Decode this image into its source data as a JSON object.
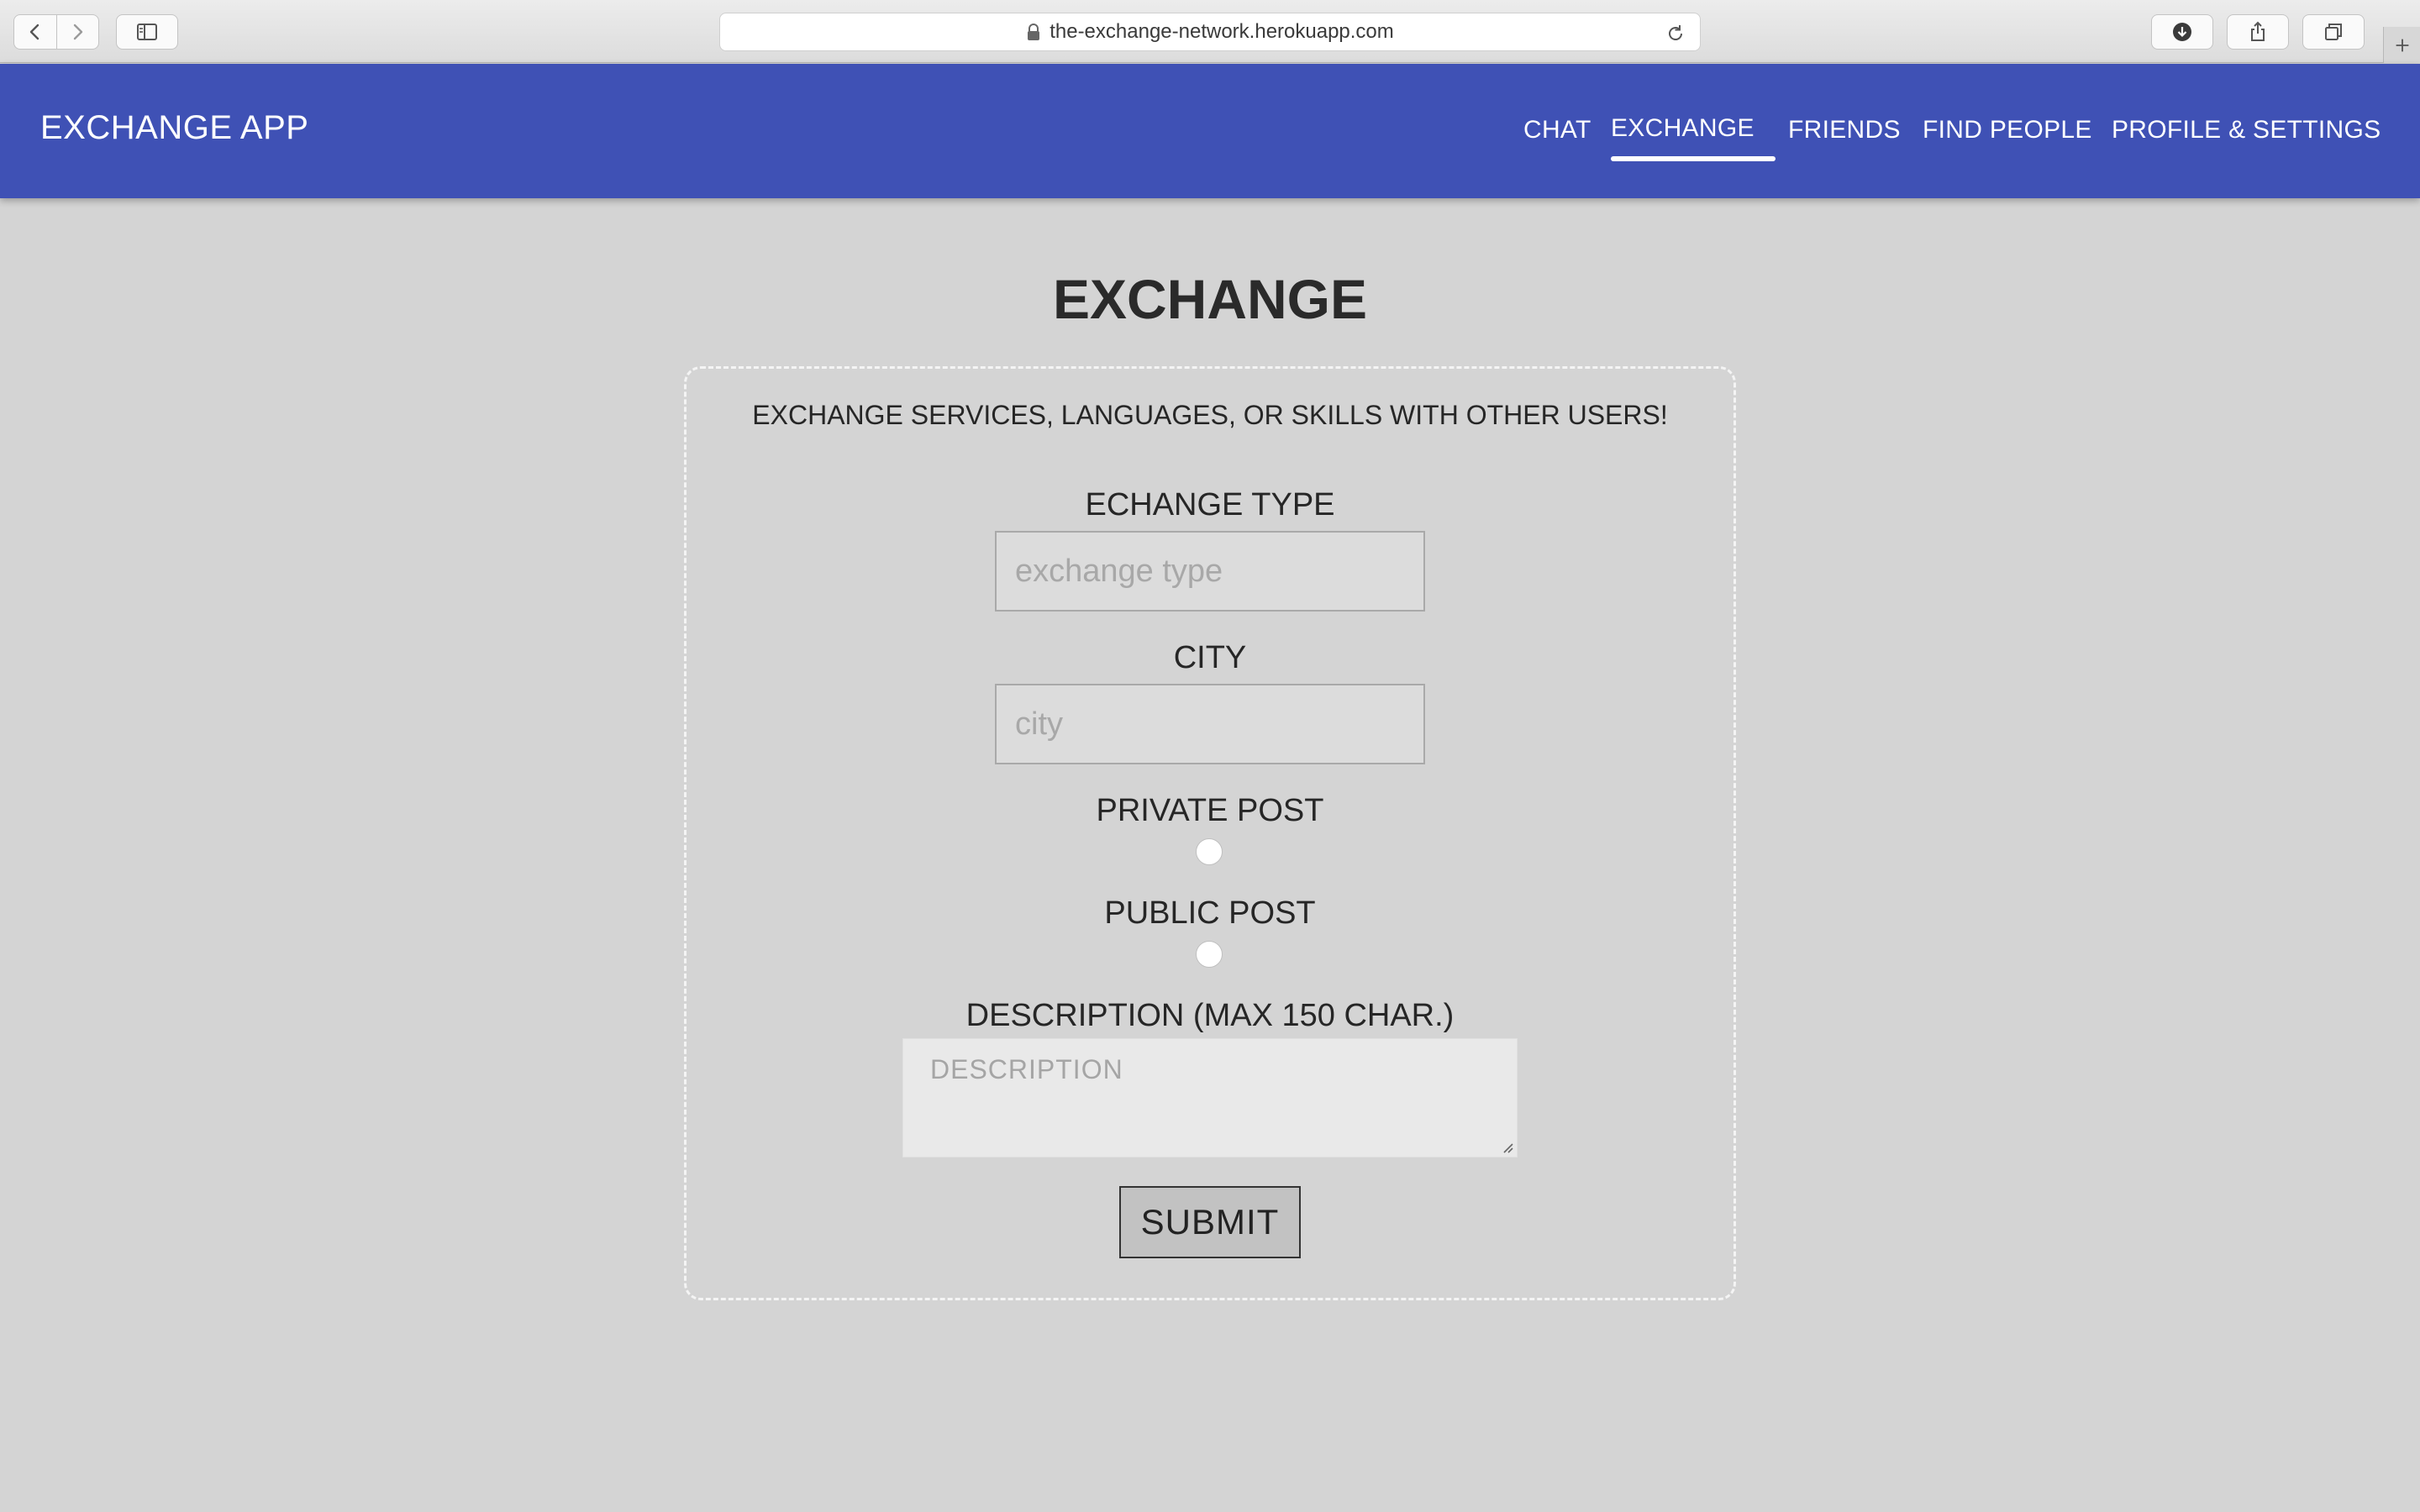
{
  "browser": {
    "url": "the-exchange-network.herokuapp.com"
  },
  "navbar": {
    "brand": "EXCHANGE APP",
    "links": [
      "CHAT",
      "EXCHANGE",
      "FRIENDS",
      "FIND PEOPLE",
      "PROFILE & SETTINGS"
    ],
    "active": "EXCHANGE",
    "color": "#3f51b5"
  },
  "main": {
    "title": "EXCHANGE",
    "intro": "EXCHANGE SERVICES, LANGUAGES, OR SKILLS WITH OTHER USERS!",
    "form": {
      "type_label": "ECHANGE TYPE",
      "type_placeholder": "exchange type",
      "city_label": "CITY",
      "city_placeholder": "city",
      "private_label": "PRIVATE POST",
      "public_label": "PUBLIC POST",
      "description_label": "DESCRIPTION (MAX 150 CHAR.)",
      "description_placeholder": "DESCRIPTION",
      "submit_label": "SUBMIT"
    }
  }
}
